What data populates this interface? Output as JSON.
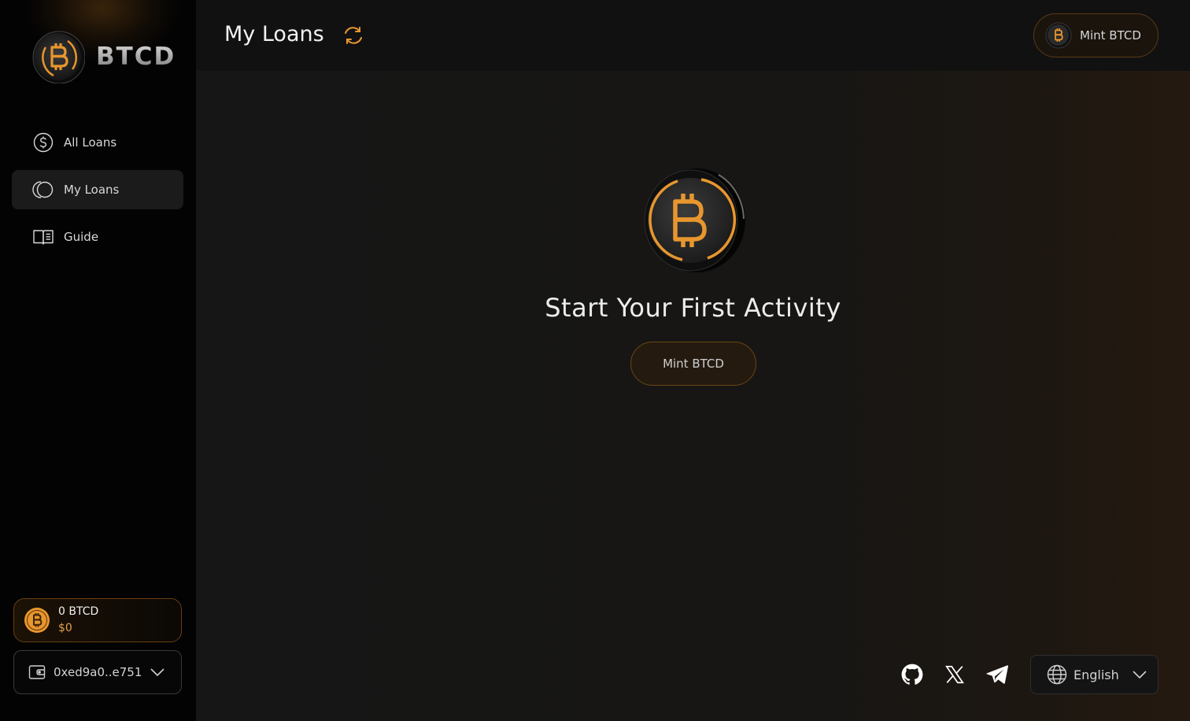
{
  "brand": {
    "name": "BTCD",
    "logo_icon": "btcd-coin-icon"
  },
  "nav": {
    "items": [
      {
        "label": "All Loans",
        "icon": "dollar-circle-icon",
        "active": false
      },
      {
        "label": "My Loans",
        "icon": "loans-circles-icon",
        "active": true
      },
      {
        "label": "Guide",
        "icon": "book-icon",
        "active": false
      }
    ]
  },
  "balance": {
    "amount": "0 BTCD",
    "usd": "$0"
  },
  "wallet": {
    "address": "0xed9a0..e751",
    "icon": "wallet-icon"
  },
  "header": {
    "title": "My Loans",
    "refresh_icon": "refresh-icon",
    "mint_label": "Mint BTCD"
  },
  "empty_state": {
    "title": "Start Your First Activity",
    "button_label": "Mint BTCD"
  },
  "footer": {
    "socials": [
      "github-icon",
      "x-icon",
      "telegram-icon"
    ],
    "language": "English"
  },
  "colors": {
    "accent": "#e8962e",
    "background": "#161616",
    "sidebar": "#030303"
  }
}
